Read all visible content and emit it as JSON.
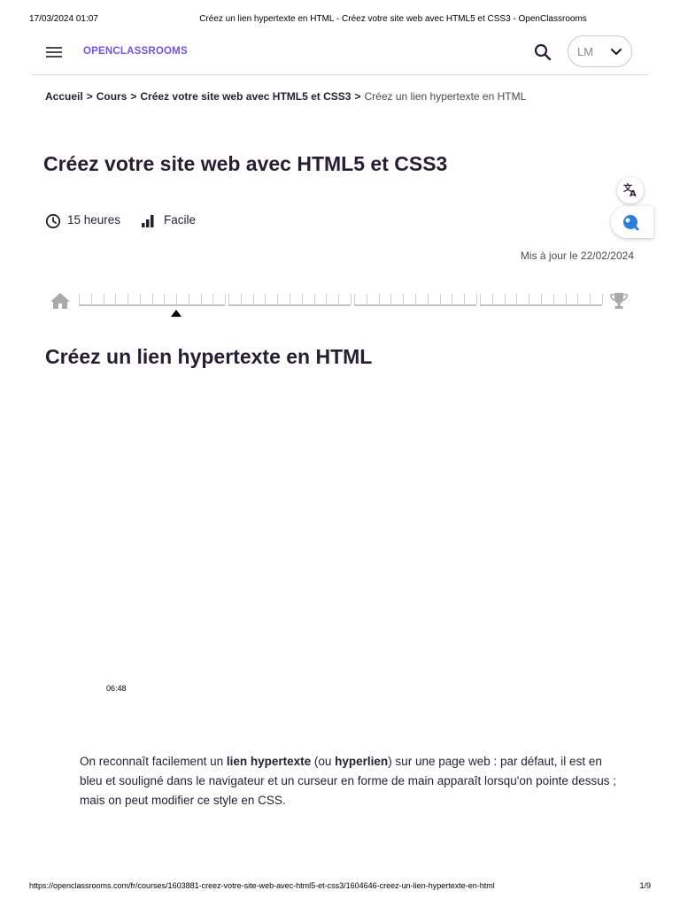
{
  "print": {
    "datetime": "17/03/2024 01:07",
    "doc_title": "Créez un lien hypertexte en HTML - Créez votre site web avec HTML5 et CSS3 - OpenClassrooms",
    "url": "https://openclassrooms.com/fr/courses/1603881-creez-votre-site-web-avec-html5-et-css3/1604646-creez-un-lien-hypertexte-en-html",
    "page": "1/9"
  },
  "header": {
    "logo": "OPENCLASSROOMS",
    "user_initials": "LM",
    "icons": [
      "hamburger-icon",
      "search-icon",
      "chevron-down-icon"
    ]
  },
  "breadcrumb": {
    "items": [
      "Accueil",
      "Cours",
      "Créez votre site web avec HTML5 et CSS3"
    ],
    "separator": ">",
    "current": "Créez un lien hypertexte en HTML"
  },
  "course": {
    "title": "Créez votre site web avec HTML5 et CSS3",
    "duration": "15 heures",
    "level": "Facile",
    "updated": "Mis à jour le 22/02/2024"
  },
  "side_buttons": [
    "translate-icon",
    "assistant-icon"
  ],
  "progress": {
    "icons": [
      "home-icon",
      "trophy-icon"
    ],
    "segment_steps": [
      12,
      10,
      10,
      10
    ],
    "current_segment": 1,
    "current_step": 8
  },
  "chapter": {
    "title": "Créez un lien hypertexte en HTML",
    "video_duration": "06:48"
  },
  "intro": {
    "t1": "On reconnaît facilement un ",
    "b1": "lien hypertexte",
    "t2": " (ou ",
    "b2": "hyperlien",
    "t3": ") sur une page web : par défaut, il est en bleu et souligné dans le navigateur et un curseur en forme de main apparaît lorsqu'on pointe dessus ; mais on peut modifier ce style en CSS."
  },
  "colors": {
    "brand": "#7451eb",
    "text": "#271d35",
    "assistant": "#2a7de1"
  }
}
